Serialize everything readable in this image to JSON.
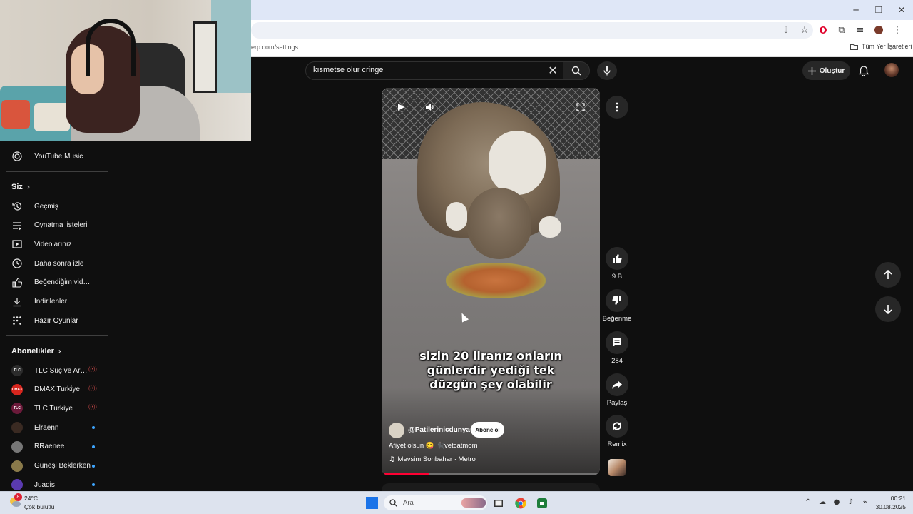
{
  "browser": {
    "bookmark_url": "erp.com/settings",
    "all_bookmarks": "Tüm Yer İşaretleri",
    "window_controls": [
      "minimize-icon",
      "restore-icon",
      "close-icon"
    ]
  },
  "header": {
    "search_query": "kısmetse olur cringe",
    "create_label": "Oluştur",
    "icons": [
      "search-icon",
      "mic-icon",
      "bell-icon",
      "clear-icon"
    ]
  },
  "sidebar": {
    "music": "YouTube Music",
    "you_section": "Siz",
    "you_items": [
      {
        "label": "Geçmiş",
        "icon": "history-icon"
      },
      {
        "label": "Oynatma listeleri",
        "icon": "playlist-icon"
      },
      {
        "label": "Videolarınız",
        "icon": "your-videos-icon"
      },
      {
        "label": "Daha sonra izle",
        "icon": "watch-later-icon"
      },
      {
        "label": "Beğendiğim videolar",
        "icon": "liked-icon"
      },
      {
        "label": "İndirilenler",
        "icon": "download-icon"
      },
      {
        "label": "Hazır Oyunlar",
        "icon": "games-icon"
      }
    ],
    "subs_section": "Abonelikler",
    "subscriptions": [
      {
        "name": "TLC Suç ve Araştırma",
        "avatar_color": "#2c2c2c",
        "avatar_text": "TLC",
        "status": "live"
      },
      {
        "name": "DMAX Turkiye",
        "avatar_color": "#d7261e",
        "avatar_text": "DMAX",
        "status": "live"
      },
      {
        "name": "TLC Turkiye",
        "avatar_color": "#6b1a3a",
        "avatar_text": "TLC",
        "status": "live"
      },
      {
        "name": "Elraenn",
        "avatar_color": "#3a2a22",
        "avatar_text": "",
        "status": "new"
      },
      {
        "name": "RRaenee",
        "avatar_color": "#777777",
        "avatar_text": "",
        "status": "new"
      },
      {
        "name": "Güneşi Beklerken",
        "avatar_color": "#8a7a4a",
        "avatar_text": "",
        "status": "new"
      },
      {
        "name": "Juadis",
        "avatar_color": "#5a3ab0",
        "avatar_text": "",
        "status": "new"
      }
    ]
  },
  "short": {
    "caption_lines": [
      "sizin 20 liranız onların",
      "günlerdir yediği tek",
      "düzgün şey olabilir"
    ],
    "channel": "@Patilerinicdunyasi",
    "subscribe": "Abone ol",
    "description": "Afiyet olsun 😋 🐈‍⬛vetcatmom",
    "music": "Mevsim Sonbahar · Metro",
    "progress": 0.22
  },
  "actions": {
    "like_count": "9 B",
    "dislike_label": "Beğenme",
    "comment_count": "284",
    "share_label": "Paylaş",
    "remix_label": "Remix"
  },
  "taskbar": {
    "weather_badge": "8",
    "weather_temp": "24°C",
    "weather_condition": "Çok bulutlu",
    "search_placeholder": "Ara",
    "time": "00:21",
    "date": "30.08.2025"
  },
  "colors": {
    "accent": "#ff0033",
    "background": "#0f0f0f",
    "surface": "#272727"
  }
}
